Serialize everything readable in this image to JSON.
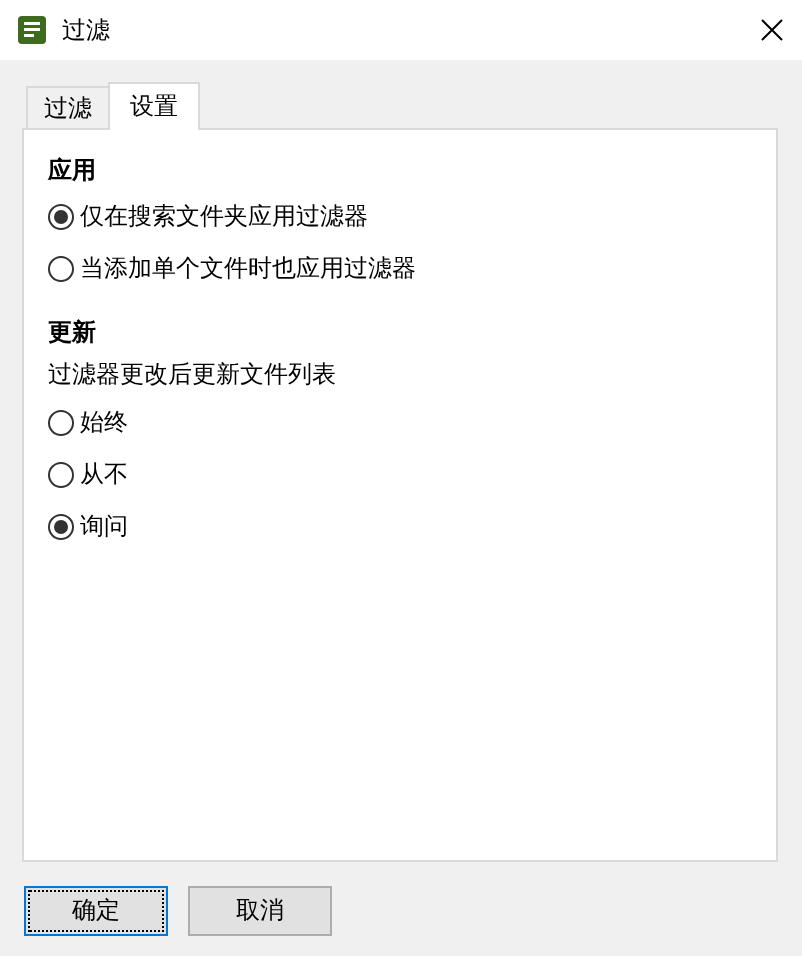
{
  "window": {
    "title": "过滤"
  },
  "tabs": [
    {
      "label": "过滤",
      "selected": false
    },
    {
      "label": "设置",
      "selected": true
    }
  ],
  "sections": [
    {
      "heading": "应用",
      "options": [
        {
          "label": "仅在搜索文件夹应用过滤器",
          "selected": true
        },
        {
          "label": "当添加单个文件时也应用过滤器",
          "selected": false
        }
      ]
    },
    {
      "heading": "更新",
      "description": "过滤器更改后更新文件列表",
      "options": [
        {
          "label": "始终",
          "selected": false
        },
        {
          "label": "从不",
          "selected": false
        },
        {
          "label": "询问",
          "selected": true
        }
      ]
    }
  ],
  "buttons": [
    {
      "label": "确定",
      "default": true
    },
    {
      "label": "取消",
      "default": false
    }
  ]
}
